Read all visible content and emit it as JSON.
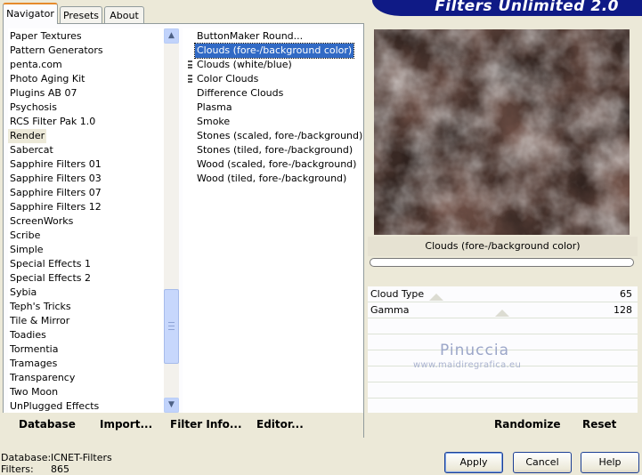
{
  "app": {
    "title": "Filters Unlimited 2.0"
  },
  "tabs": [
    {
      "label": "Navigator",
      "active": true
    },
    {
      "label": "Presets",
      "active": false
    },
    {
      "label": "About",
      "active": false
    }
  ],
  "categories": [
    "Paper Textures",
    "Pattern Generators",
    "penta.com",
    "Photo Aging Kit",
    "Plugins AB 07",
    "Psychosis",
    "RCS Filter Pak 1.0",
    "Render",
    "Sabercat",
    "Sapphire Filters 01",
    "Sapphire Filters 03",
    "Sapphire Filters 07",
    "Sapphire Filters 12",
    "ScreenWorks",
    "Scribe",
    "Simple",
    "Special Effects 1",
    "Special Effects 2",
    "Sybia",
    "Teph's Tricks",
    "Tile & Mirror",
    "Toadies",
    "Tormentia",
    "Tramages",
    "Transparency",
    "Two Moon",
    "UnPlugged Effects"
  ],
  "selected_category": "Render",
  "filters": [
    "ButtonMaker Round...",
    "Clouds (fore-/background color)",
    "Clouds (white/blue)",
    "Color Clouds",
    "Difference Clouds",
    "Plasma",
    "Smoke",
    "Stones (scaled, fore-/background)",
    "Stones (tiled, fore-/background)",
    "Wood (scaled, fore-/background)",
    "Wood (tiled, fore-/background)"
  ],
  "selected_filter": "Clouds (fore-/background color)",
  "left_buttons": {
    "database": "Database",
    "import": "Import...",
    "filter_info": "Filter Info...",
    "editor": "Editor..."
  },
  "right_buttons": {
    "randomize": "Randomize",
    "reset": "Reset"
  },
  "preview": {
    "filter_name": "Clouds (fore-/background color)"
  },
  "params": [
    {
      "name": "Cloud Type",
      "value": "65",
      "level": 65
    },
    {
      "name": "Gamma",
      "value": "128",
      "level": 128
    }
  ],
  "watermark": {
    "name": "Pinuccia",
    "url": "www.maidiregrafica.eu"
  },
  "status": {
    "database_label": "Database:",
    "database_value": "ICNET-Filters",
    "filters_label": "Filters:",
    "filters_value": "865"
  },
  "dialog_buttons": {
    "apply": "Apply",
    "cancel": "Cancel",
    "help": "Help"
  },
  "colors": {
    "selection": "#316ac5",
    "banner": "#0f1a86",
    "cloud_dark": "#8c6559",
    "cloud_light": "#ffffff"
  },
  "icons": {
    "scroll_up": "scroll-up-arrow-icon",
    "scroll_down": "scroll-down-arrow-icon"
  }
}
